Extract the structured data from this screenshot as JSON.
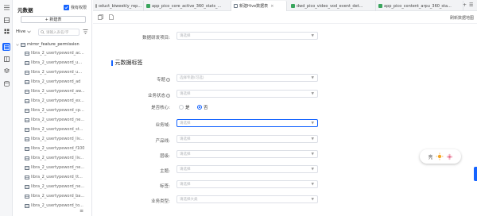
{
  "sidebar": {
    "title": "元数据",
    "checkbox_label": "我有权限",
    "new_button": "+ 新建表",
    "source_select": "Hive",
    "search_placeholder": "请输入表名/字",
    "tree_root": "mirror_feature_permission",
    "items": [
      "libra_2_usertypeword_ac...",
      "libra_2_usertypeword_u...",
      "libra_2_usertypeword_u...",
      "libra_2_usertypeword_ad",
      "libra_2_usertypeword_aw...",
      "libra_2_usertypeword_ex...",
      "libra_2_usertypeword_cp...",
      "libra_2_usertypeword_ne...",
      "libra_2_usertypeword_st...",
      "libra_2_usertypeword_liv...",
      "libra_2_usertypeword_f100",
      "libra_2_usertypeword_liv...",
      "libra_2_usertypeword_ne...",
      "libra_2_usertypeword_tt...",
      "libra_2_usertypeword_ne...",
      "libra_2_usertypeword_ba...",
      "libra_2_usertypeword_to..."
    ],
    "bottom_icon": "≡"
  },
  "tabs": [
    {
      "label": "oduct_biweekly_rep...",
      "color": "#ffffff"
    },
    {
      "label": "app_pico_core_active_360_stats_...",
      "color": "#3aa55d"
    },
    {
      "label": "新建Hive数据表",
      "color": "#6b7785"
    },
    {
      "label": "dwd_pico_video_vod_event_det...",
      "color": "#3aa55d"
    },
    {
      "label": "app_pico_content_arpu_360_sta...",
      "color": "#3aa55d"
    }
  ],
  "tab_controls": {
    "add": "+",
    "menu": "☰"
  },
  "toolbar": {
    "right_label": "刷新数据地图"
  },
  "form": {
    "top_field_label": "数据研发项目:",
    "top_field_placeholder": "请选择",
    "section_title": "元数据标签",
    "fields": [
      {
        "label": "专题",
        "has_help": true,
        "placeholder": "选择专题(可选)"
      },
      {
        "label": "业务状态",
        "has_help": true,
        "placeholder": "请选择"
      },
      {
        "label": "是否核心:",
        "has_help": false,
        "placeholder": ""
      },
      {
        "label": "业务域:",
        "has_help": false,
        "placeholder": "请选择"
      },
      {
        "label": "产品线:",
        "has_help": false,
        "placeholder": "请选择"
      },
      {
        "label": "层级:",
        "has_help": false,
        "placeholder": "请选择"
      },
      {
        "label": "主题:",
        "has_help": false,
        "placeholder": "请选择"
      },
      {
        "label": "标签:",
        "has_help": false,
        "placeholder": "请选择"
      },
      {
        "label": "业务类型:",
        "has_help": false,
        "placeholder": "请选择大类"
      }
    ],
    "core_options": {
      "yes": "是",
      "no": "否",
      "selected": "否"
    }
  },
  "floating_widget": {
    "text": "亮",
    "icon": "sun-icon"
  },
  "colors": {
    "accent": "#1664ff",
    "rail_bg": "#f5f6f8"
  }
}
